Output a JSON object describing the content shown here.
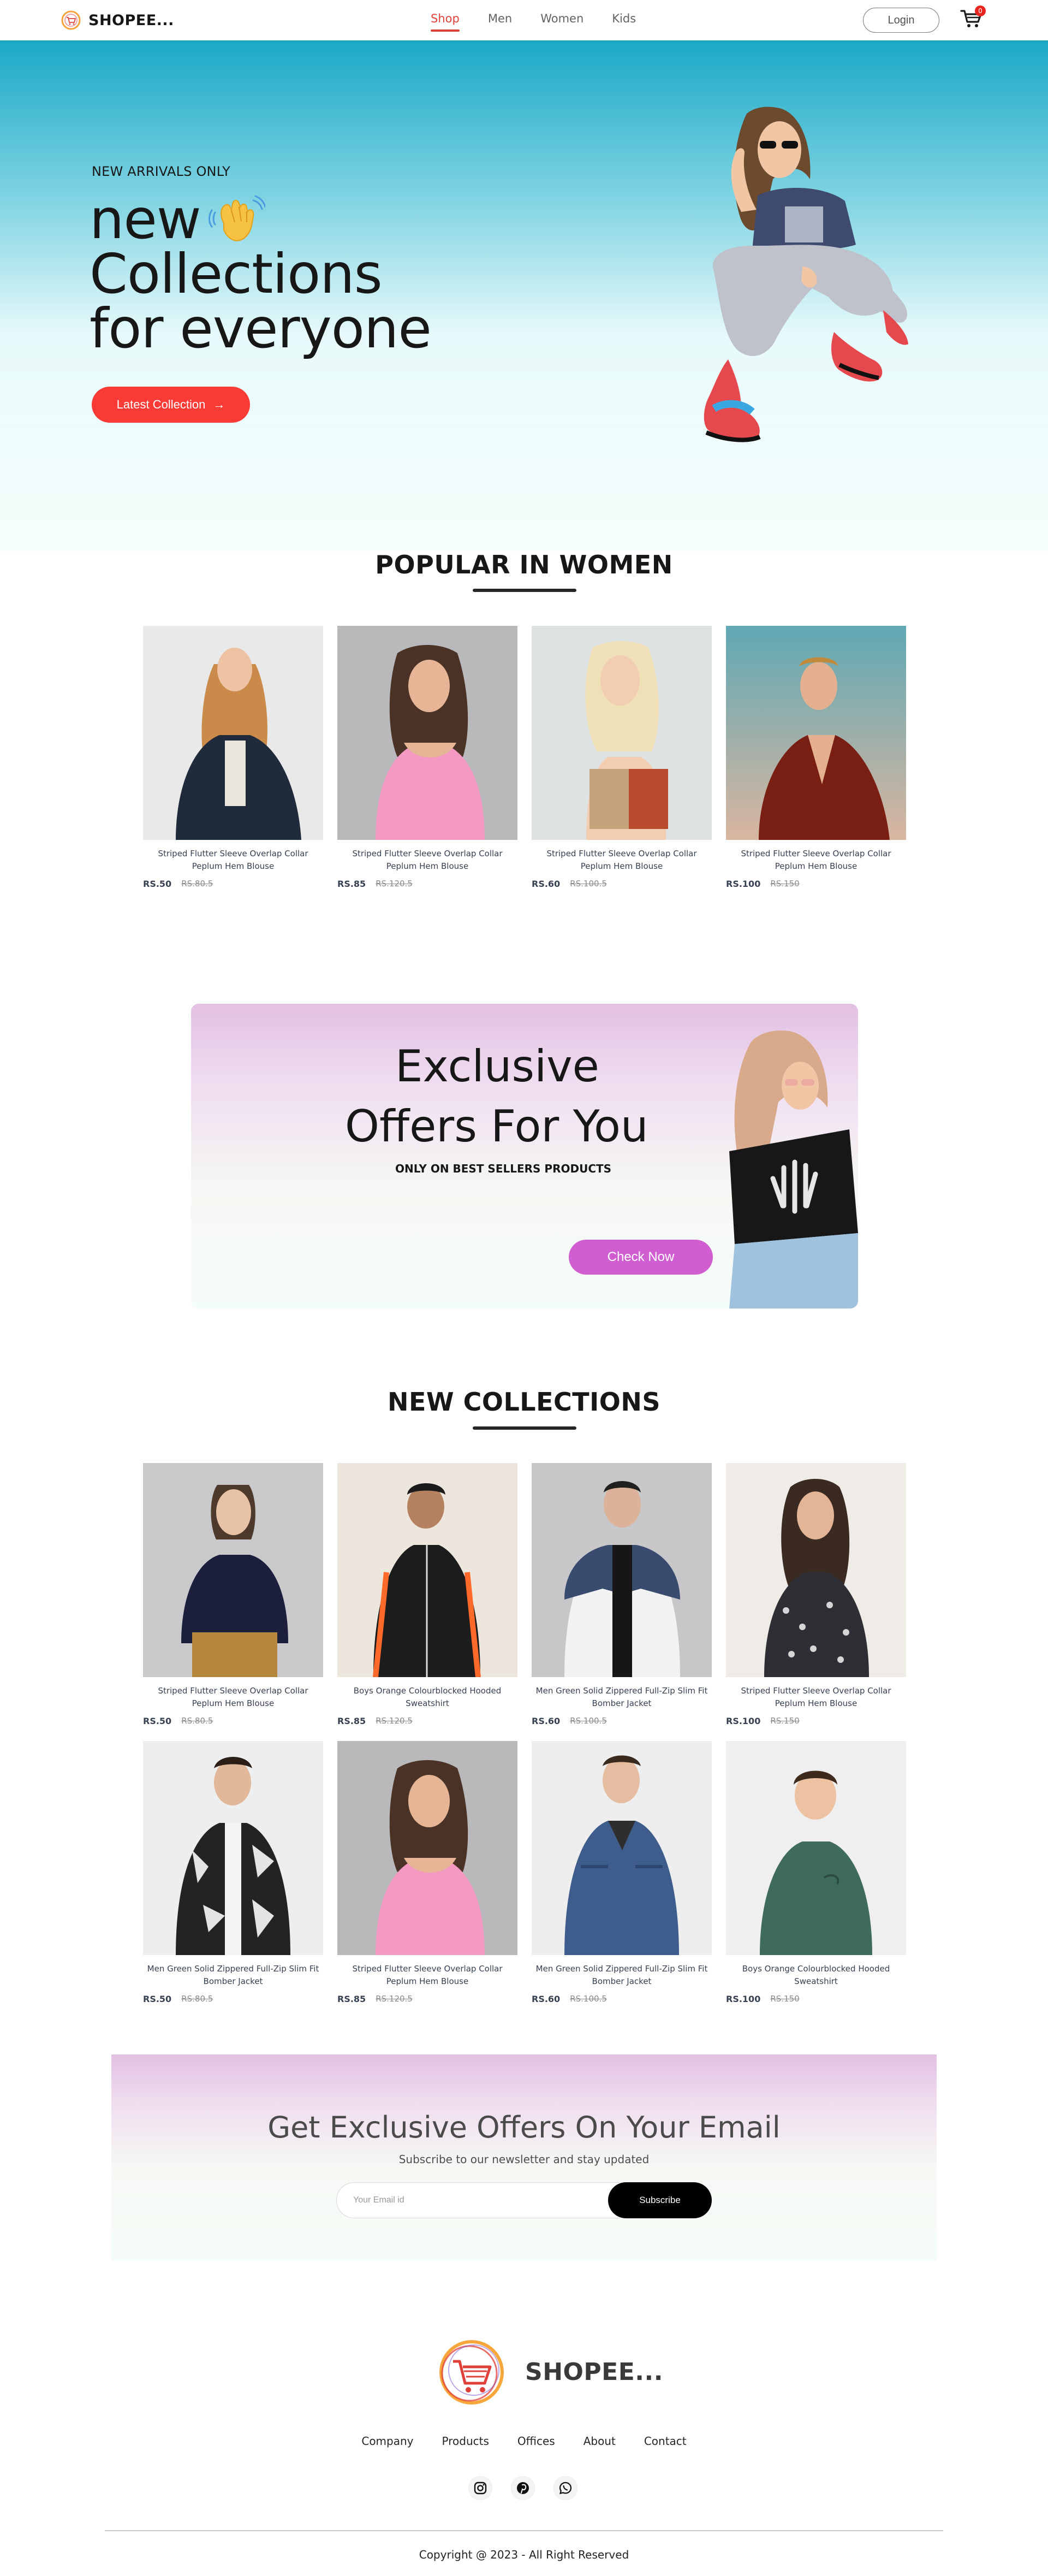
{
  "navbar": {
    "brand": "SHOPEE...",
    "menu": [
      "Shop",
      "Men",
      "Women",
      "Kids"
    ],
    "active_menu": "Shop",
    "login_label": "Login",
    "cart_count": "0"
  },
  "hero": {
    "kicker": "NEW ARRIVALS ONLY",
    "line1": "new",
    "line2": "Collections",
    "line3": "for everyone",
    "button_label": "Latest Collection",
    "button_arrow": "→"
  },
  "popular": {
    "title": "POPULAR IN WOMEN",
    "items": [
      {
        "name": "Striped Flutter Sleeve Overlap Collar Peplum Hem Blouse",
        "price": "RS.50",
        "old_price": "RS.80.5"
      },
      {
        "name": "Striped Flutter Sleeve Overlap Collar Peplum Hem Blouse",
        "price": "RS.85",
        "old_price": "RS.120.5"
      },
      {
        "name": "Striped Flutter Sleeve Overlap Collar Peplum Hem Blouse",
        "price": "RS.60",
        "old_price": "RS.100.5"
      },
      {
        "name": "Striped Flutter Sleeve Overlap Collar Peplum Hem Blouse",
        "price": "RS.100",
        "old_price": "RS.150"
      }
    ]
  },
  "offers": {
    "title_line1": "Exclusive",
    "title_line2": "Offers For You",
    "subtitle": "ONLY ON BEST SELLERS PRODUCTS",
    "button_label": "Check Now"
  },
  "new_collections": {
    "title": "NEW COLLECTIONS",
    "items": [
      {
        "name": "Striped Flutter Sleeve Overlap Collar Peplum Hem Blouse",
        "price": "RS.50",
        "old_price": "RS.80.5"
      },
      {
        "name": "Boys Orange Colourblocked Hooded Sweatshirt",
        "price": "RS.85",
        "old_price": "RS.120.5"
      },
      {
        "name": "Men Green Solid Zippered Full-Zip Slim Fit Bomber Jacket",
        "price": "RS.60",
        "old_price": "RS.100.5"
      },
      {
        "name": "Striped Flutter Sleeve Overlap Collar Peplum Hem Blouse",
        "price": "RS.100",
        "old_price": "RS.150"
      },
      {
        "name": "Men Green Solid Zippered Full-Zip Slim Fit Bomber Jacket",
        "price": "RS.50",
        "old_price": "RS.80.5"
      },
      {
        "name": "Striped Flutter Sleeve Overlap Collar Peplum Hem Blouse",
        "price": "RS.85",
        "old_price": "RS.120.5"
      },
      {
        "name": "Men Green Solid Zippered Full-Zip Slim Fit Bomber Jacket",
        "price": "RS.60",
        "old_price": "RS.100.5"
      },
      {
        "name": "Boys Orange Colourblocked Hooded Sweatshirt",
        "price": "RS.100",
        "old_price": "RS.150"
      }
    ]
  },
  "newsletter": {
    "title": "Get Exclusive Offers On Your Email",
    "subtitle": "Subscribe to our newsletter and stay updated",
    "placeholder": "Your Email id",
    "button_label": "Subscribe"
  },
  "footer": {
    "brand": "SHOPEE...",
    "links": [
      "Company",
      "Products",
      "Offices",
      "About",
      "Contact"
    ],
    "social_icons": [
      "instagram-icon",
      "pinterest-icon",
      "whatsapp-icon"
    ],
    "copyright": "Copyright @ 2023 - All Right Reserved"
  },
  "colors": {
    "accent_red": "#f93a35",
    "offer_purple": "#d05ed1",
    "hero_teal": "#1ba9c7",
    "text_dark": "#171717"
  }
}
